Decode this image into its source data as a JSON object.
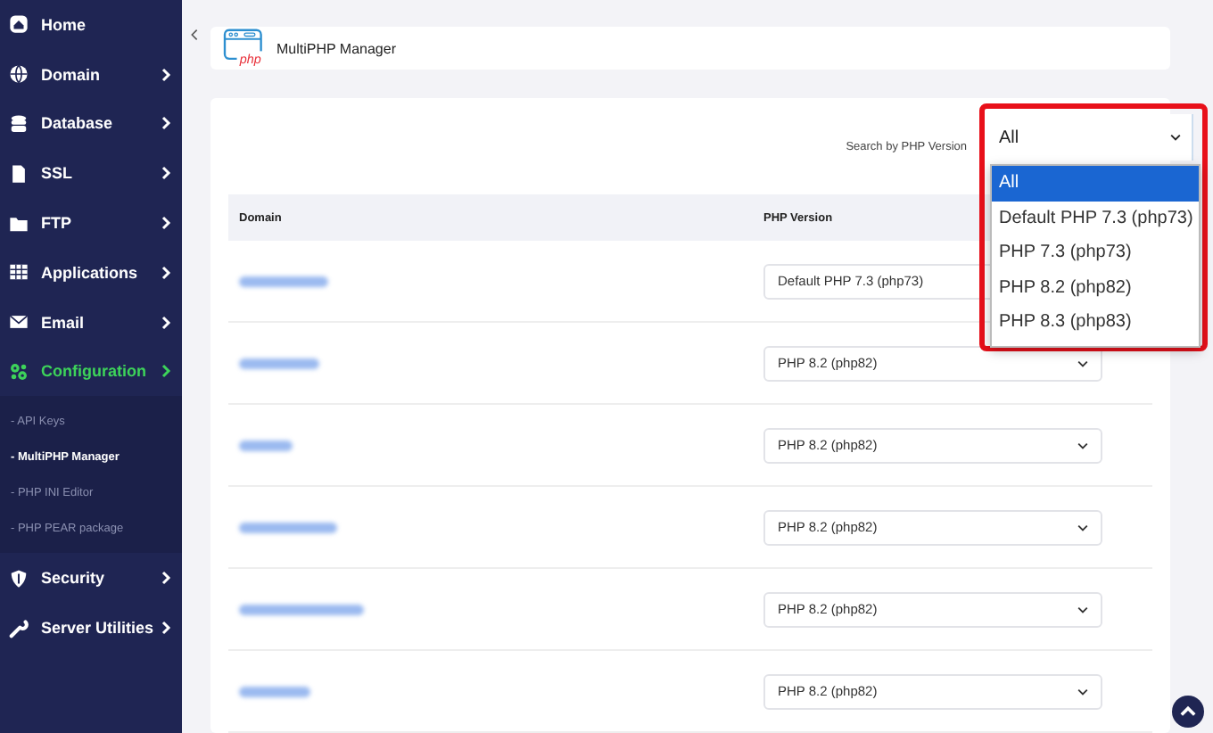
{
  "sidebar": {
    "items": [
      {
        "label": "Home",
        "selected": false
      },
      {
        "label": "Domain",
        "selected": false
      },
      {
        "label": "Database",
        "selected": false
      },
      {
        "label": "SSL",
        "selected": false
      },
      {
        "label": "FTP",
        "selected": false
      },
      {
        "label": "Applications",
        "selected": false
      },
      {
        "label": "Email",
        "selected": false
      },
      {
        "label": "Configuration",
        "selected": true,
        "children": [
          {
            "label": "- API Keys",
            "selected": false
          },
          {
            "label": "- MultiPHP Manager",
            "selected": true
          },
          {
            "label": "- PHP INI Editor",
            "selected": false
          },
          {
            "label": "- PHP PEAR package",
            "selected": false
          }
        ]
      },
      {
        "label": "Security",
        "selected": false
      },
      {
        "label": "Server Utilities",
        "selected": false
      }
    ]
  },
  "header": {
    "title": "MultiPHP Manager",
    "icon_text": "php"
  },
  "filter": {
    "label": "Search by PHP Version",
    "value": "All",
    "options": [
      {
        "label": "All",
        "selected": true
      },
      {
        "label": "Default PHP 7.3 (php73)",
        "selected": false
      },
      {
        "label": "PHP 7.3 (php73)",
        "selected": false
      },
      {
        "label": "PHP 8.2 (php82)",
        "selected": false
      },
      {
        "label": "PHP 8.3 (php83)",
        "selected": false
      }
    ]
  },
  "table": {
    "columns": [
      "Domain",
      "PHP Version"
    ],
    "rows": [
      {
        "version": "Default PHP 7.3 (php73)"
      },
      {
        "version": "PHP 8.2 (php82)"
      },
      {
        "version": "PHP 8.2 (php82)"
      },
      {
        "version": "PHP 8.2 (php82)"
      },
      {
        "version": "PHP 8.2 (php82)"
      },
      {
        "version": "PHP 8.2 (php82)"
      }
    ]
  }
}
